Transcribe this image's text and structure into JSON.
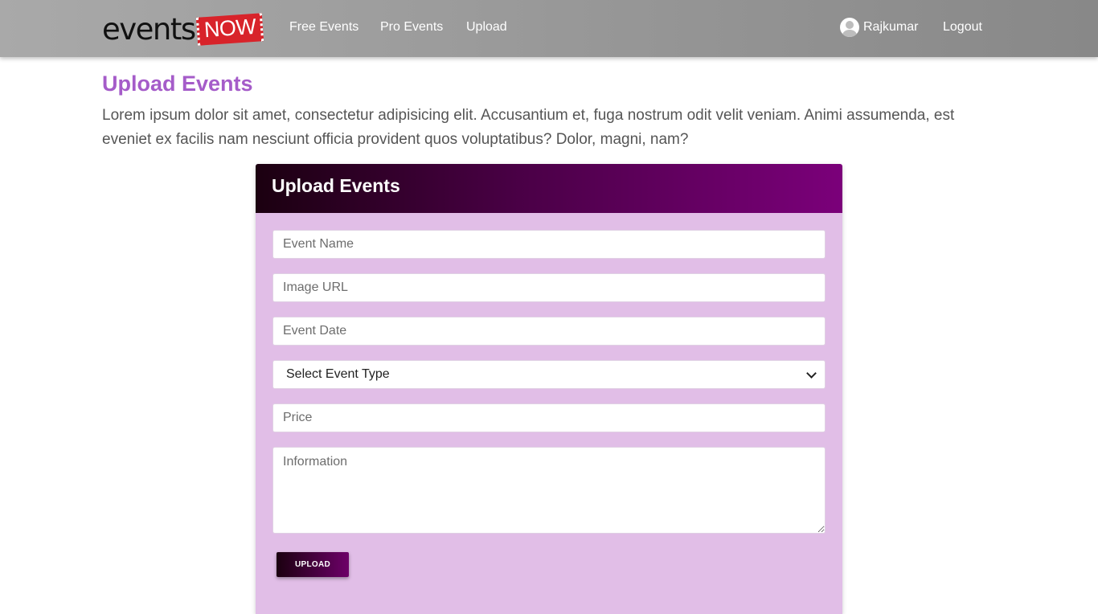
{
  "brand": {
    "logo_text": "events",
    "logo_badge": "NOW"
  },
  "nav": {
    "links": [
      {
        "label": "Free Events"
      },
      {
        "label": "Pro Events"
      },
      {
        "label": "Upload"
      }
    ],
    "user_name": "Rajkumar",
    "logout_label": "Logout"
  },
  "page": {
    "title": "Upload Events",
    "intro": "Lorem ipsum dolor sit amet, consectetur adipisicing elit. Accusantium et, fuga nostrum odit velit veniam. Animi assumenda, est eveniet ex facilis nam nesciunt officia provident quos voluptatibus? Dolor, magni, nam?"
  },
  "form": {
    "title": "Upload Events",
    "event_name_placeholder": "Event Name",
    "image_url_placeholder": "Image URL",
    "event_date_placeholder": "Event Date",
    "event_type_selected": "Select Event Type",
    "price_placeholder": "Price",
    "information_placeholder": "Information",
    "submit_label": "UPLOAD"
  },
  "colors": {
    "accent_title": "#a55cc9",
    "card_background": "#e1bee7",
    "header_gradient_start": "#1b0010",
    "header_gradient_end": "#7b007a",
    "navbar": "#999999"
  },
  "icons": {
    "avatar": "user-avatar-icon",
    "select_chevron": "chevron-down-icon"
  }
}
